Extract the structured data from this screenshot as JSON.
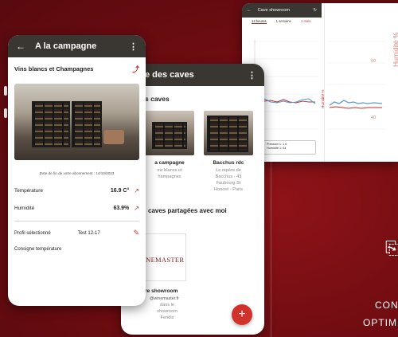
{
  "phone1": {
    "title": "A la campagne",
    "subtitle": "Vins blancs et Champagnes",
    "subscription_date": "Date de fin de votre abonnement : 14/10/2023",
    "rows": [
      {
        "label": "Température",
        "value": "16.9 C°"
      },
      {
        "label": "Humidité",
        "value": "63.9%"
      }
    ],
    "profile_label": "Profil sélectionné",
    "profile_value": "Test 12-17",
    "setpoint_label": "Consigne température"
  },
  "phone2": {
    "title": "e des caves",
    "section1": "s caves",
    "cards": [
      {
        "name": "a campagne",
        "desc_line1": "ins blancs et",
        "desc_line2": "hampagnes"
      },
      {
        "name": "Bacchus rdc",
        "desc_line1": "Le repère de",
        "desc_line2": "Bacchus - 43",
        "desc_line3": "Faubourg St",
        "desc_line4": "Honoré - Paris"
      }
    ],
    "section2": "caves partagées avec moi",
    "logo_text": "INEMASTER",
    "shared_name": "re showroom",
    "shared_email": "@winemaster.fr",
    "shared_desc1": "dans le",
    "shared_desc2": "showroom",
    "shared_desc3": "Fendis",
    "fab": "+"
  },
  "phone3": {
    "title": "Cave showroom",
    "tabs": [
      "12 heures",
      "1 semaine",
      "1 mois"
    ],
    "y_labels_right": [
      "60",
      "40"
    ],
    "axis_title": "Humidité %",
    "axis_title_small": "Humidité %",
    "legend_line1": "Pression 1: 1.6",
    "legend_line2": "Humidité 1: 64"
  },
  "side": {
    "caption_line1": "CON",
    "caption_line2": "OPTIM"
  }
}
